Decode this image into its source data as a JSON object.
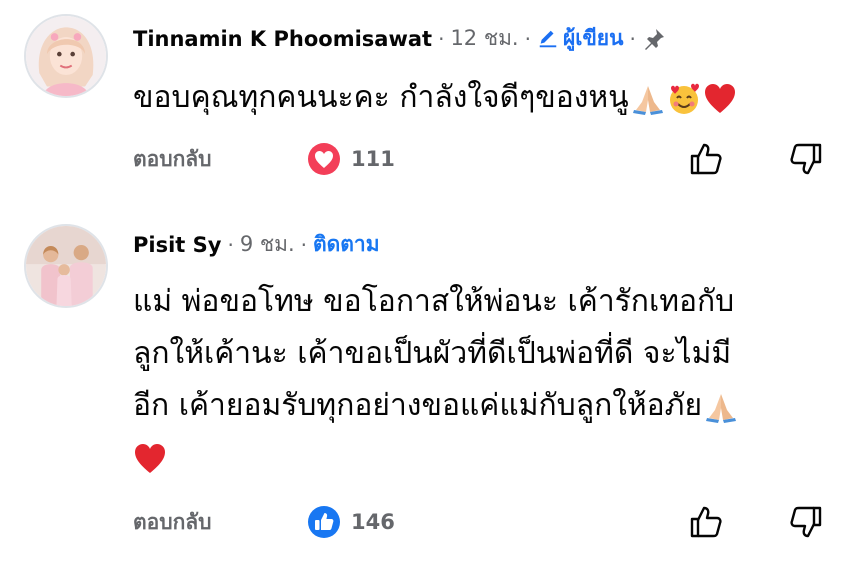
{
  "comments": [
    {
      "author": "Tinnamin K Phoomisawat",
      "time": "12 ชม.",
      "author_badge": "ผู้เขียน",
      "text_lines": [
        "ขอบคุณทุกคนนะคะ กำลังใจดีๆของหนู"
      ],
      "emojis": [
        "folded-hands",
        "smiling-face-with-hearts",
        "red-heart"
      ],
      "reply_label": "ตอบกลับ",
      "reaction_type": "love",
      "reaction_count": "111"
    },
    {
      "author": "Pisit Sy",
      "time": "9 ชม.",
      "follow_label": "ติดตาม",
      "text_lines": [
        "แม่ พ่อขอโทษ ขอโอกาสให้พ่อนะ เค้ารักเทอกับ",
        "ลูกให้เค้านะ เค้าขอเป็นผัวที่ดีเป็นพ่อที่ดี จะไม่มี",
        "อีก เค้ายอมรับทุกอย่างขอแค่แม่กับลูกให้อภัย"
      ],
      "emojis": [
        "folded-hands",
        "red-heart"
      ],
      "reply_label": "ตอบกลับ",
      "reaction_type": "like",
      "reaction_count": "146"
    }
  ],
  "colors": {
    "text": "#050505",
    "secondary": "#65676b",
    "link": "#1877f2",
    "love": "#f33e58",
    "like": "#1877f2"
  }
}
